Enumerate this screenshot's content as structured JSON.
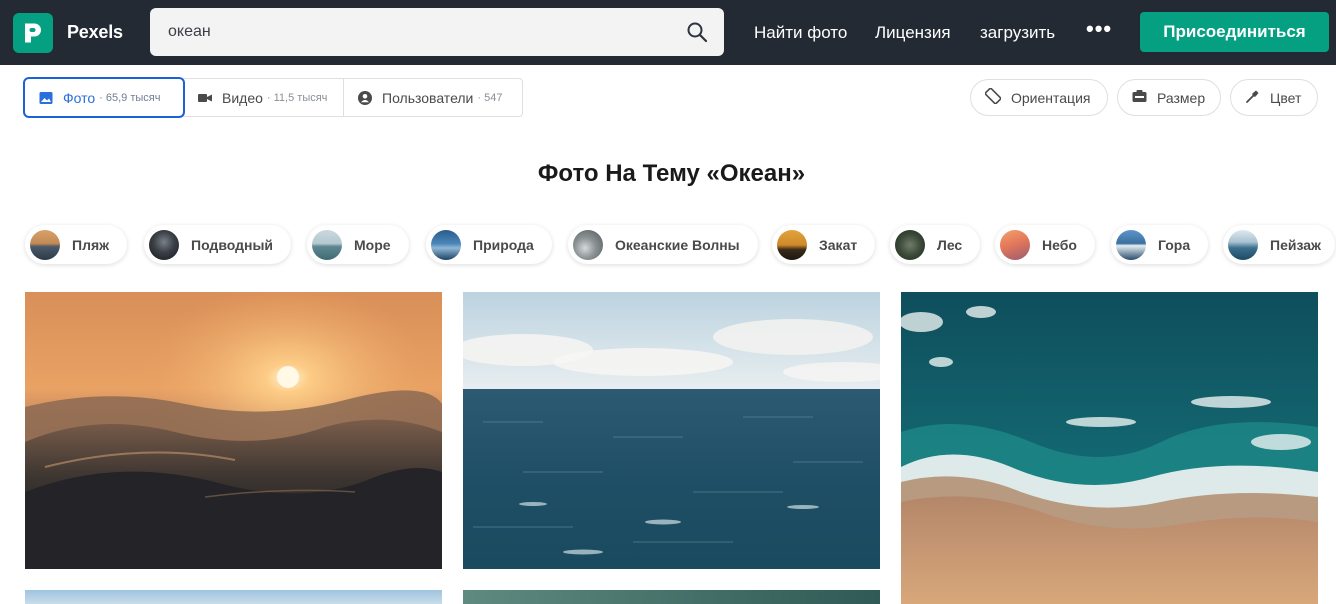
{
  "header": {
    "brand": "Pexels",
    "search": {
      "value": "океан"
    },
    "nav": [
      "Найти фото",
      "Лицензия",
      "загрузить"
    ],
    "more": "•••",
    "join_label": "Присоединиться"
  },
  "tabs": [
    {
      "label": "Фото",
      "count": "· 65,9 тысяч",
      "icon": "image-icon",
      "active": true
    },
    {
      "label": "Видео",
      "count": "· 11,5 тысяч",
      "icon": "video-icon",
      "active": false
    },
    {
      "label": "Пользователи",
      "count": "· 547",
      "icon": "user-icon",
      "active": false
    }
  ],
  "filters": [
    {
      "label": "Ориентация",
      "icon": "orientation-icon"
    },
    {
      "label": "Размер",
      "icon": "size-icon"
    },
    {
      "label": "Цвет",
      "icon": "color-picker-icon"
    }
  ],
  "page_title": "Фото На Тему «Океан»",
  "related": [
    "Пляж",
    "Подводный",
    "Море",
    "Природа",
    "Океанские Волны",
    "Закат",
    "Лес",
    "Небо",
    "Гора",
    "Пейзаж"
  ],
  "colors": {
    "brand": "#05a081",
    "header_bg": "#232a34",
    "active_tab": "#1a62d6"
  }
}
